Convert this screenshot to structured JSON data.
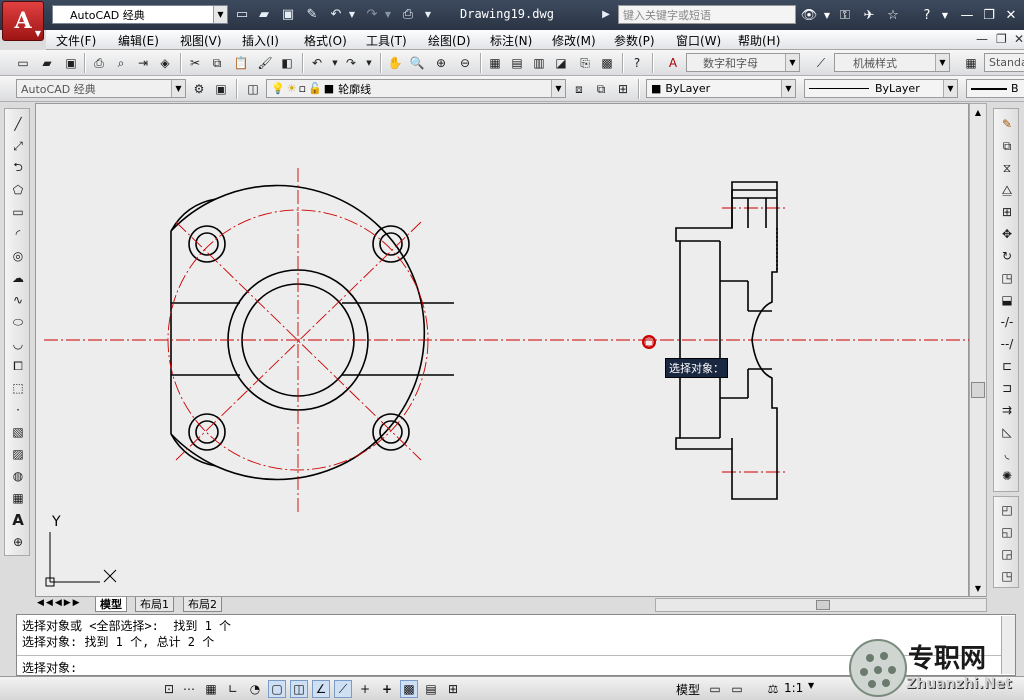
{
  "title_bar": {
    "app_button_letter": "A",
    "workspace": "AutoCAD 经典",
    "document_title": "Drawing19.dwg",
    "search_placeholder": "键入关键字或短语"
  },
  "menu": [
    "文件(F)",
    "编辑(E)",
    "视图(V)",
    "插入(I)",
    "格式(O)",
    "工具(T)",
    "绘图(D)",
    "标注(N)",
    "修改(M)",
    "参数(P)",
    "窗口(W)",
    "帮助(H)"
  ],
  "toolbar1": {
    "text_style": "数字和字母",
    "dim_style": "机械样式",
    "table_style": "Standa"
  },
  "toolbar2": {
    "workspace_combo": "AutoCAD 经典",
    "layer": "轮廓线",
    "color": "ByLayer",
    "linetype": "ByLayer",
    "lineweight": "B"
  },
  "ucs": {
    "x_label": "X",
    "y_label": "Y"
  },
  "canvas": {
    "tooltip": "选择对象："
  },
  "tabs": [
    "模型",
    "布局1",
    "布局2"
  ],
  "command": {
    "line1": "选择对象或 <全部选择>:  找到 1 个",
    "line2": "选择对象: 找到 1 个, 总计 2 个",
    "prompt": "选择对象:"
  },
  "status": {
    "model": "模型",
    "scale": "1:1"
  },
  "watermark": {
    "text": "专职网",
    "url": "Zhuanzhi.Net"
  },
  "colors": {
    "title_bar": "#2f3a4c",
    "geometry": "#000000",
    "center_line": "#cc0000",
    "canvas": "#ededed"
  }
}
